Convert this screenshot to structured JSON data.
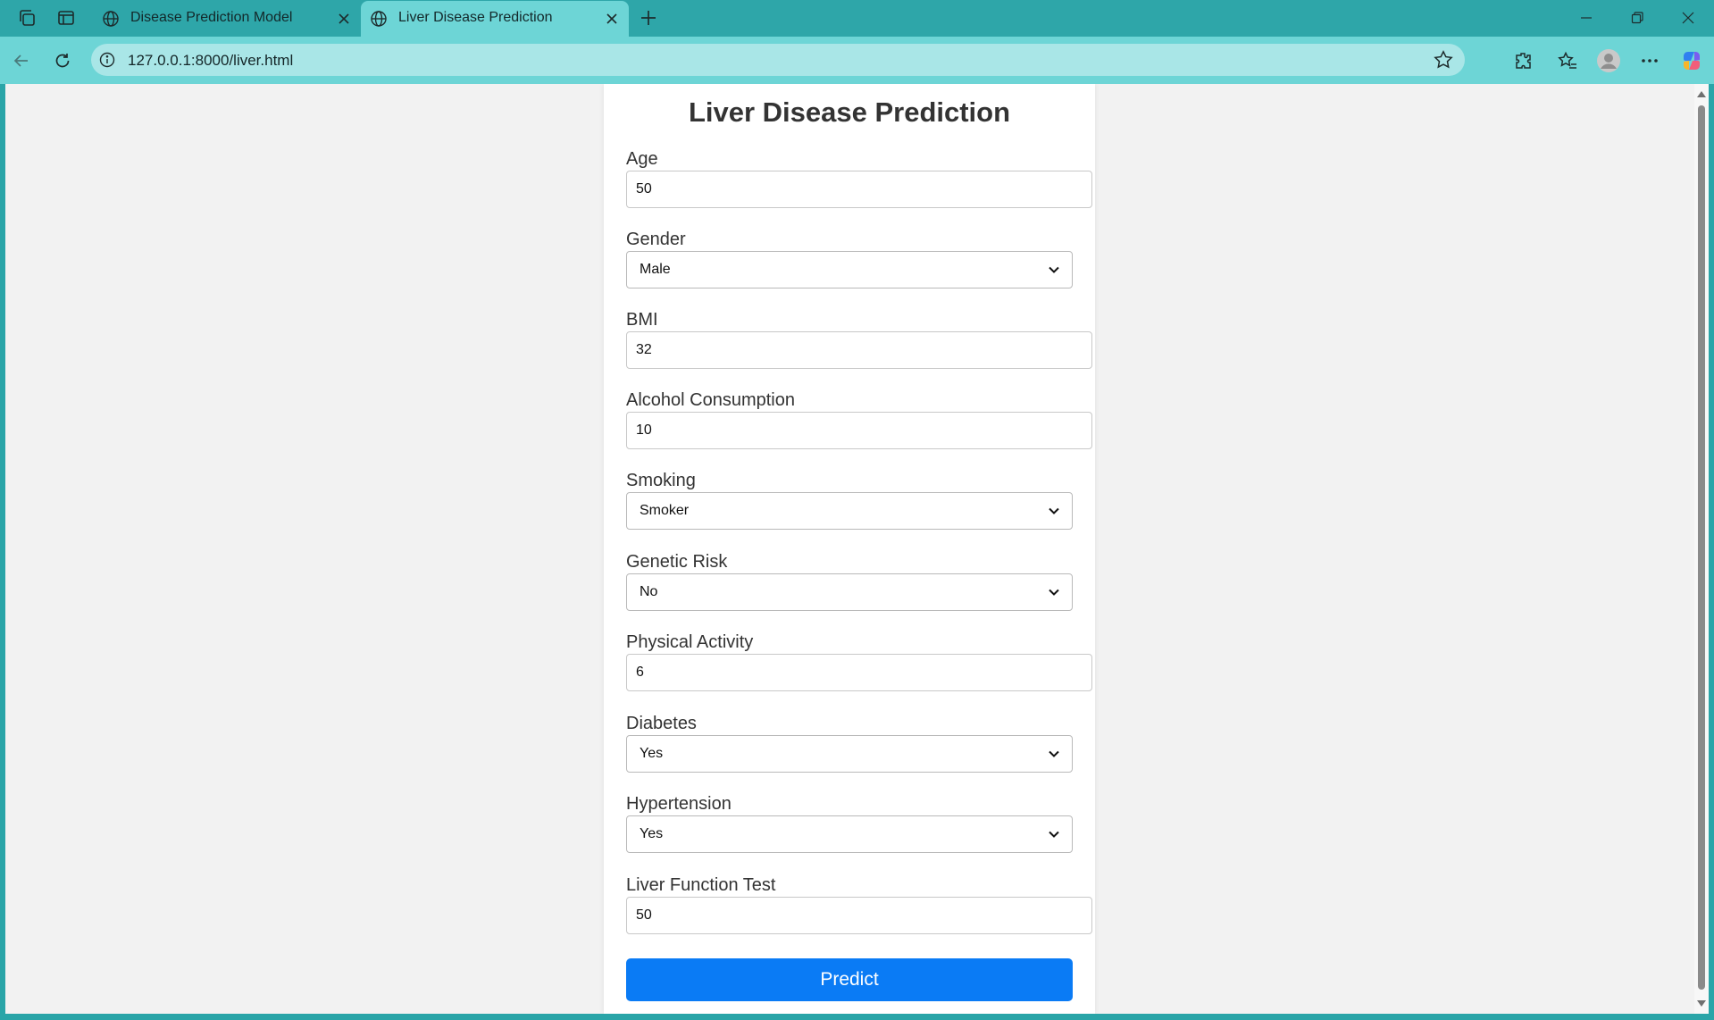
{
  "browser": {
    "tabs": [
      {
        "title": "Disease Prediction Model",
        "active": false
      },
      {
        "title": "Liver Disease Prediction",
        "active": true
      }
    ],
    "url": "127.0.0.1:8000/liver.html"
  },
  "form": {
    "title": "Liver Disease Prediction",
    "fields": [
      {
        "label": "Age",
        "type": "input",
        "value": "50"
      },
      {
        "label": "Gender",
        "type": "select",
        "value": "Male"
      },
      {
        "label": "BMI",
        "type": "input",
        "value": "32"
      },
      {
        "label": "Alcohol Consumption",
        "type": "input",
        "value": "10"
      },
      {
        "label": "Smoking",
        "type": "select",
        "value": "Smoker"
      },
      {
        "label": "Genetic Risk",
        "type": "select",
        "value": "No"
      },
      {
        "label": "Physical Activity",
        "type": "input",
        "value": "6"
      },
      {
        "label": "Diabetes",
        "type": "select",
        "value": "Yes"
      },
      {
        "label": "Hypertension",
        "type": "select",
        "value": "Yes"
      },
      {
        "label": "Liver Function Test",
        "type": "input",
        "value": "50"
      }
    ],
    "submit_label": "Predict"
  },
  "colors": {
    "frame": "#2ea6a9",
    "toolbar": "#6dd5d6",
    "omnibox": "#a9e6e7",
    "primary_button": "#0a7bf5"
  }
}
